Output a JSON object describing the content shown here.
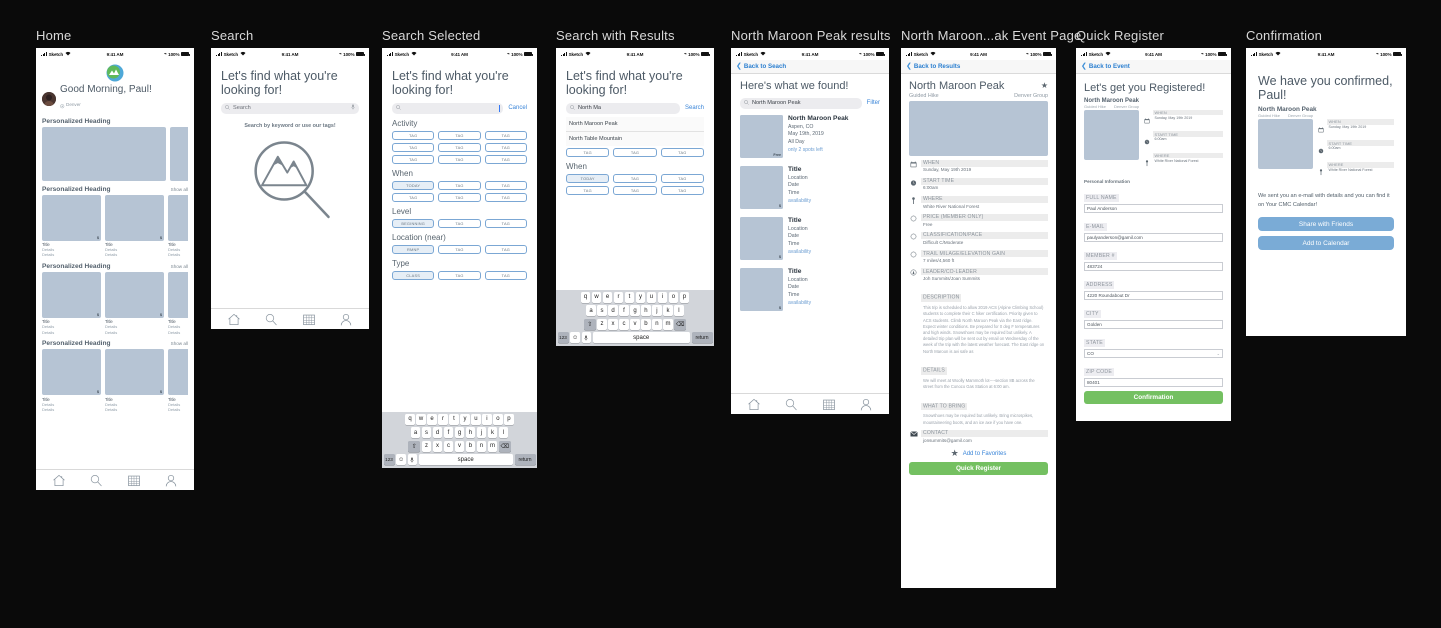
{
  "statusbar": {
    "carrier": "Sketch",
    "time": "9:41 AM",
    "battery": "100%"
  },
  "screens": [
    {
      "id": "home",
      "title": "Home",
      "greeting": "Good Morning, Paul!",
      "location": "Denver",
      "sections": [
        {
          "heading": "Personalized Heading",
          "show_all": ""
        },
        {
          "heading": "Personalized Heading",
          "show_all": "Show all"
        },
        {
          "heading": "Personalized Heading",
          "show_all": "Show all"
        },
        {
          "heading": "Personalized Heading",
          "show_all": "Show all"
        }
      ],
      "card": {
        "title": "Title",
        "detail1": "Details",
        "detail2": "Details",
        "price": "$"
      }
    },
    {
      "id": "search",
      "title": "Search",
      "headline": "Let's find what you're looking for!",
      "search_placeholder": "Search",
      "hint": "Search by keyword or use our tags!"
    },
    {
      "id": "search-selected",
      "title": "Search Selected",
      "headline": "Let's find what you're looking for!",
      "search_value": "",
      "cancel_label": "Cancel",
      "facets": [
        {
          "label": "Activity",
          "tags": [
            "TAG",
            "TAG",
            "TAG",
            "TAG",
            "TAG",
            "TAG",
            "TAG",
            "TAG",
            "TAG"
          ],
          "active": []
        },
        {
          "label": "When",
          "tags": [
            "TODAY",
            "TAG",
            "TAG",
            "TAG",
            "TAG",
            "TAG"
          ],
          "active": [
            0
          ]
        },
        {
          "label": "Level",
          "tags": [
            "BEGINNING",
            "TAG",
            "TAG"
          ],
          "active": [
            0
          ]
        },
        {
          "label": "Location (near)",
          "tags": [
            "RMNP",
            "TAG",
            "TAG"
          ],
          "active": [
            0
          ]
        },
        {
          "label": "Type",
          "tags": [
            "CLASS",
            "TAG",
            "TAG"
          ],
          "active": [
            0
          ]
        }
      ]
    },
    {
      "id": "search-results",
      "title": "Search with Results",
      "headline": "Let's find what you're looking for!",
      "search_value": "North Ma",
      "search_action": "Search",
      "suggestions": [
        "North Maroon Peak",
        "North Table Mountain"
      ],
      "facets": [
        {
          "label": "",
          "tags": [
            "TAG",
            "TAG",
            "TAG"
          ]
        },
        {
          "label": "When",
          "tags": [
            "TODAY",
            "TAG",
            "TAG",
            "TAG",
            "TAG",
            "TAG"
          ]
        }
      ]
    },
    {
      "id": "peak-results",
      "title": "North Maroon Peak results",
      "back_label": "Back to Seach",
      "headline": "Here's what we found!",
      "search_value": "North Maroon Peak",
      "filter_label": "Filter",
      "results": [
        {
          "title": "North Maroon Peak",
          "location": "Aspen, CO",
          "date": "May 19th, 2019",
          "time": "All Day",
          "price": "Free",
          "availability": "only 2 spots left"
        },
        {
          "title": "Title",
          "location": "Location",
          "date": "Date",
          "time": "Time",
          "price": "$",
          "availability": "availability"
        },
        {
          "title": "Title",
          "location": "Location",
          "date": "Date",
          "time": "Time",
          "price": "$",
          "availability": "availability"
        },
        {
          "title": "Title",
          "location": "Location",
          "date": "Date",
          "time": "Time",
          "price": "$",
          "availability": "availability"
        }
      ]
    },
    {
      "id": "event-page",
      "title": "North Maroon...ak Event Page",
      "back_label": "Back to Results",
      "event_title": "North Maroon Peak",
      "event_type": "Guided Hike",
      "event_group": "Denver Group",
      "details": [
        {
          "icon": "calendar-icon",
          "label": "WHEN",
          "value": "Sunday, May 19th 2019"
        },
        {
          "icon": "clock-icon",
          "label": "START TIME",
          "value": "6:00am"
        },
        {
          "icon": "pin-icon",
          "label": "WHERE",
          "value": "White River National Forest"
        },
        {
          "icon": "circle-icon",
          "label": "PRICE (MEMBER ONLY)",
          "value": "Free"
        },
        {
          "icon": "circle-icon",
          "label": "CLASSIFICATION/PACE",
          "value": "Difficult C/Moderate"
        },
        {
          "icon": "circle-icon",
          "label": "TRAIL MILAGE/ELEVATION GAIN",
          "value": "7 miles/4,560 ft"
        },
        {
          "icon": "leader-icon",
          "label": "LEADER/CO-LEADER",
          "value": "Joh Summits/Joan Summits"
        }
      ],
      "description_label": "DESCRIPTION",
      "description": "This trip is scheduled to allow 2019 ACS (Alpine Climbing School) students to complete their C hiker certification. Priority given to ACS students.  Climb North Maroon Peak via the East ridge. Expect winter conditions.  Be prepared for 0 deg F temperatures and high winds. Snowshoes may be required but unlikely. A detailed trip plan will be sent out by email on Wednesday of the week of the trip with the latest weather forecast.  The East ridge on North Maroon is avi safe as",
      "details_label": "DETAILS",
      "details_text": "We will meet at  Woolly Mammoth  lot----section 8B across the street from the Conoco Gas Station at 6:00 am.",
      "bring_label": "WHAT TO BRING",
      "bring_text": "Snowshoes may be required but unlikely.  Bring microspikes, mountaineering boots, and an ice axe if you have one.",
      "contact_label": "CONTACT",
      "contact_value": "jonsummits@gamil.com",
      "favorite_label": "Add to Favorites",
      "cta_label": "Quick Register"
    },
    {
      "id": "quick-register",
      "title": "Quick Register",
      "back_label": "Back to Event",
      "headline": "Let's get you Registered!",
      "event_title": "North Maroon Peak",
      "event_type": "Guided Hike",
      "event_group": "Denver Group",
      "mini_details": [
        {
          "icon": "calendar-icon",
          "label": "WHEN",
          "value": "Sunday, May 19th 2019"
        },
        {
          "icon": "clock-icon",
          "label": "START TIME",
          "value": "6:00am"
        },
        {
          "icon": "pin-icon",
          "label": "WHERE",
          "value": "White River National Forest"
        }
      ],
      "form_heading": "Personal Information",
      "fields": [
        {
          "label": "FULL NAME",
          "value": "Paul Anderson",
          "type": "text"
        },
        {
          "label": "E-MAIL",
          "value": "paulyanderson@gamil.com",
          "type": "text"
        },
        {
          "label": "MEMBER #",
          "value": "483724",
          "type": "text"
        },
        {
          "label": "ADDRESS",
          "value": "4220 Roundabout Dr",
          "type": "text"
        },
        {
          "label": "CITY",
          "value": "Golden",
          "type": "text"
        },
        {
          "label": "STATE",
          "value": "CO",
          "type": "select"
        },
        {
          "label": "ZIP CODE",
          "value": "80401",
          "type": "text"
        }
      ],
      "cta_label": "Confirmation"
    },
    {
      "id": "confirmation",
      "title": "Confirmation",
      "headline": "We have you confirmed, Paul!",
      "event_title": "North Maroon Peak",
      "event_type": "Guided Hike",
      "event_group": "Denver Group",
      "mini_details": [
        {
          "icon": "calendar-icon",
          "label": "WHEN",
          "value": "Sunday, May 19th 2019"
        },
        {
          "icon": "clock-icon",
          "label": "START TIME",
          "value": "6:00am"
        },
        {
          "icon": "pin-icon",
          "label": "WHERE",
          "value": "White River National Forest"
        }
      ],
      "message": "We sent you an e-mail with details and you can find it on Your CMC Calendar!",
      "buttons": [
        "Share with Friends",
        "Add to Calendar"
      ]
    }
  ],
  "keyboard": {
    "row1": [
      "q",
      "w",
      "e",
      "r",
      "t",
      "y",
      "u",
      "i",
      "o",
      "p"
    ],
    "row2": [
      "a",
      "s",
      "d",
      "f",
      "g",
      "h",
      "j",
      "k",
      "l"
    ],
    "row3": [
      "z",
      "x",
      "c",
      "v",
      "b",
      "n",
      "m"
    ],
    "shift": "⇧",
    "backspace": "⌫",
    "num": "123",
    "emoji": "☺",
    "mic": "🎤",
    "space": "space",
    "return": "return"
  },
  "tabbar": {
    "items": [
      {
        "name": "home-tab",
        "label": ""
      },
      {
        "name": "search-tab",
        "label": ""
      },
      {
        "name": "calendar-tab",
        "label": ""
      },
      {
        "name": "profile-tab",
        "label": ""
      }
    ]
  },
  "colors": {
    "accent_blue": "#3a85d8",
    "green_cta": "#74c061",
    "blue_btn": "#7aabd6",
    "placeholder_block": "#b6c4d4"
  }
}
